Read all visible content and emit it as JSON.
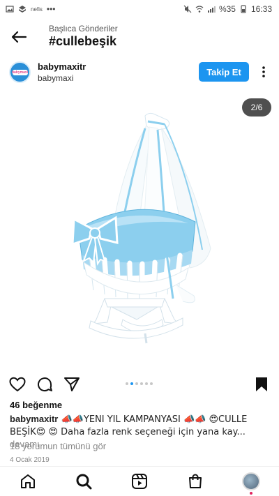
{
  "status_bar": {
    "left_icons": [
      "image-icon",
      "dropbox-icon",
      "app-icon"
    ],
    "app_label": "nefis",
    "more": "•••",
    "battery": "%35",
    "time": "16:33"
  },
  "header": {
    "subtitle": "Başlıca Gönderiler",
    "title": "#cullebeşik"
  },
  "post": {
    "username": "babymaxitr",
    "subname": "babymaxi",
    "avatar_text": "babymaxi",
    "follow_label": "Takip Et",
    "image_counter": "2/6",
    "likes": "46 beğenme",
    "caption_user": "babymaxitr",
    "caption_text": " 📣📣YENI YIL KAMPANYASI 📣📣 😍CULLE BEŞİK😍 😍 Daha fazla renk seçeneği için yana kay... ",
    "caption_more": "devamı",
    "comments_link": "18 yorumun tümünü gör",
    "date": "4 Ocak 2019"
  },
  "carousel": {
    "total": 6,
    "active_index": 1
  },
  "colors": {
    "accent": "#1c95f0",
    "cradle_blue": "#8ccfee",
    "wood_white": "#ffffff"
  },
  "icons": {
    "back": "arrow-left-icon",
    "more": "more-vertical-icon",
    "like": "heart-icon",
    "comment": "comment-icon",
    "share": "send-icon",
    "save": "bookmark-icon",
    "home": "home-icon",
    "search": "search-icon",
    "reels": "reels-icon",
    "shop": "shop-icon"
  }
}
